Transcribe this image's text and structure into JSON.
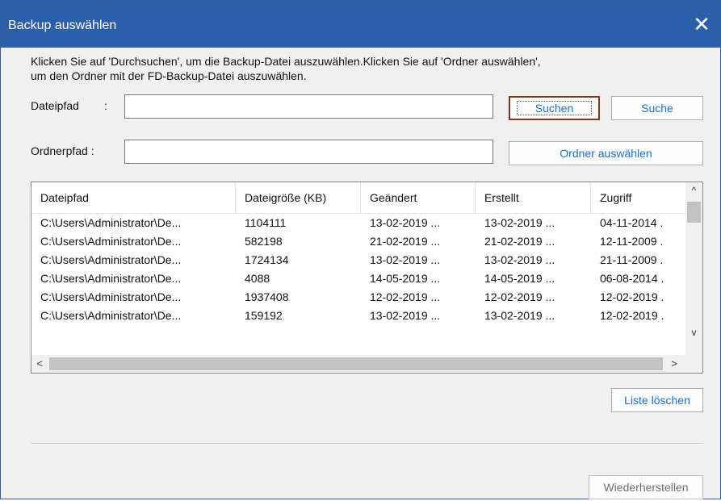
{
  "window": {
    "title": "Backup auswählen",
    "close_glyph": "✕"
  },
  "instructions": {
    "line1": "Klicken Sie auf 'Durchsuchen', um die Backup-Datei auszuwählen.Klicken Sie auf 'Ordner auswählen',",
    "line2": "um den Ordner mit der FD-Backup-Datei auszuwählen."
  },
  "file_path": {
    "label": "Dateipfad",
    "colon": ":",
    "value": "",
    "browse_label": "Suchen",
    "search_label": "Suche"
  },
  "folder_path": {
    "label": "Ordnerpfad :",
    "value": "",
    "select_label": "Ordner auswählen"
  },
  "table": {
    "columns": [
      "Dateipfad",
      "Dateigröße (KB)",
      "Geändert",
      "Erstellt",
      "Zugriff"
    ],
    "rows": [
      [
        "C:\\Users\\Administrator\\De...",
        "1104111",
        "13-02-2019 ...",
        "13-02-2019 ...",
        "04-11-2014 ."
      ],
      [
        "C:\\Users\\Administrator\\De...",
        "582198",
        "21-02-2019 ...",
        "21-02-2019 ...",
        "12-11-2009 ."
      ],
      [
        "C:\\Users\\Administrator\\De...",
        "1724134",
        "13-02-2019 ...",
        "13-02-2019 ...",
        "21-11-2009 ."
      ],
      [
        "C:\\Users\\Administrator\\De...",
        "4088",
        "14-05-2019 ...",
        "14-05-2019 ...",
        "06-08-2014 ."
      ],
      [
        "C:\\Users\\Administrator\\De...",
        "1937408",
        "12-02-2019 ...",
        "12-02-2019 ...",
        "12-02-2019 ."
      ],
      [
        "C:\\Users\\Administrator\\De...",
        "159192",
        "13-02-2019 ...",
        "13-02-2019 ...",
        "12-02-2019 ."
      ]
    ],
    "scroll_up_glyph": "^",
    "scroll_down_glyph": "v",
    "scroll_left_glyph": "<",
    "scroll_right_glyph": ">"
  },
  "clear_list_label": "Liste löschen",
  "restore_label": "Wiederherstellen",
  "colors": {
    "titlebar": "#2c5ea9",
    "button_text": "#1a6fd1",
    "focus_border": "#7b3a1e"
  }
}
